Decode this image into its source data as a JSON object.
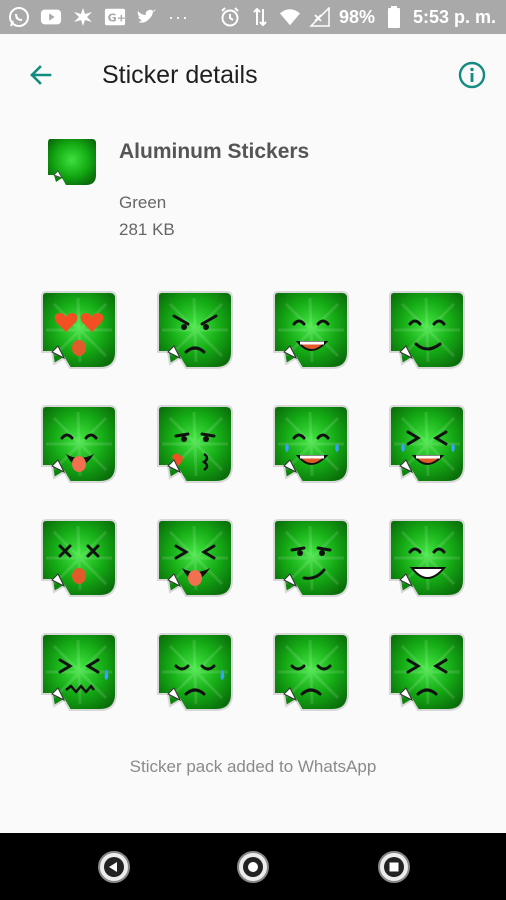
{
  "status_bar": {
    "left_icons": [
      "whatsapp-icon",
      "youtube-icon",
      "leaf-icon",
      "google-plus-icon",
      "twitter-icon"
    ],
    "more": "···",
    "right_icons": [
      "alarm-icon",
      "data-arrows-icon",
      "wifi-icon",
      "no-signal-icon"
    ],
    "battery": "98%",
    "time": "5:53 p. m."
  },
  "app_bar": {
    "title": "Sticker details",
    "back_icon": "arrow-left-icon",
    "info_icon": "info-icon",
    "accent_color": "#128c7e"
  },
  "pack": {
    "name": "Aluminum Stickers",
    "publisher": "Green",
    "size": "281 KB"
  },
  "stickers": [
    {
      "face": "heart-eyes"
    },
    {
      "face": "angry"
    },
    {
      "face": "grin"
    },
    {
      "face": "smile"
    },
    {
      "face": "tongue-out"
    },
    {
      "face": "kiss"
    },
    {
      "face": "tears-of-joy"
    },
    {
      "face": "laughing-tears"
    },
    {
      "face": "dizzy"
    },
    {
      "face": "squint-tongue"
    },
    {
      "face": "smirk"
    },
    {
      "face": "teeth-grin"
    },
    {
      "face": "confounded-sweat"
    },
    {
      "face": "sad-tear"
    },
    {
      "face": "disappointed"
    },
    {
      "face": "persevering"
    }
  ],
  "footer_message": "Sticker pack added to WhatsApp",
  "nav_bar": {
    "back_icon": "nav-back-icon",
    "home_icon": "nav-home-icon",
    "recents_icon": "nav-recents-icon"
  },
  "colors": {
    "sticker_green": "#12a812",
    "status_bar": "#a9a9a9",
    "background": "#fafafa"
  }
}
